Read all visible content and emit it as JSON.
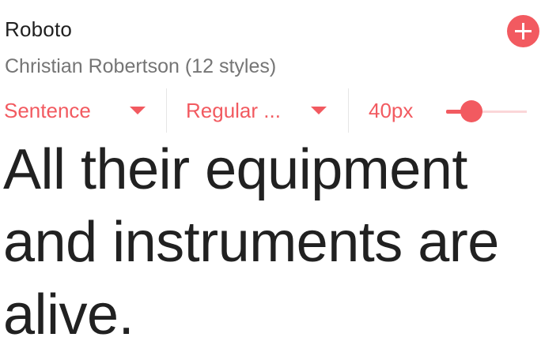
{
  "font": {
    "name": "Roboto",
    "designer_line": "Christian Robertson (12 styles)"
  },
  "add_button": {
    "icon": "plus-icon"
  },
  "controls": {
    "sample_type": "Sentence",
    "weight": "Regular ...",
    "size_label": "40px",
    "size_fraction": 0.31
  },
  "preview": {
    "text": "All their equipment and instruments are alive."
  },
  "colors": {
    "accent": "#f25a60",
    "accent_light": "#fbd6d8",
    "text_dark": "#212121",
    "text_muted": "#757575"
  }
}
